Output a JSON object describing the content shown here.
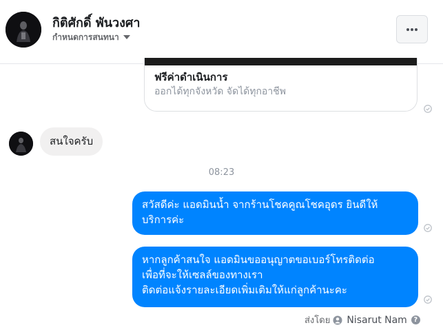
{
  "header": {
    "name": "กิติศักดิ์ พันวงศา",
    "subtitle": "กำหนดการสนทนา",
    "more_label": "..."
  },
  "link_card": {
    "title": "ฟรีค่าดำเนินการ",
    "description": "ออกได้ทุกจังหวัด จัดได้ทุกอาชีพ"
  },
  "messages": {
    "incoming": {
      "text": "สนใจครับ"
    },
    "timestamp": "08:23",
    "outgoing": [
      {
        "lines": [
          "สวัสดีค่ะ แอดมินน้ำ จากร้านโชคคูณโชคอุดร ยินดีให้",
          "บริการค่ะ"
        ]
      },
      {
        "lines": [
          "หากลูกค้าสนใจ แอดมินขออนุญาตขอเบอร์โทรติดต่อ",
          "เพื่อที่จะให้เซลล์ของทางเรา",
          "ติดต่อแจ้งรายละเอียดเพิ่มเติมให้แก่ลูกค้านะคะ"
        ]
      }
    ]
  },
  "sent_by": {
    "label": "ส่งโดย",
    "name": "Nisarut Nam",
    "help": "?"
  },
  "colors": {
    "outgoing_bubble": "#0084ff",
    "incoming_bubble": "#f1f0f0",
    "status_icon": "#bec3c9"
  },
  "icons": [
    "avatar",
    "caret-down-icon",
    "more-icon",
    "seen-check-icon",
    "sender-icon",
    "help-icon"
  ]
}
